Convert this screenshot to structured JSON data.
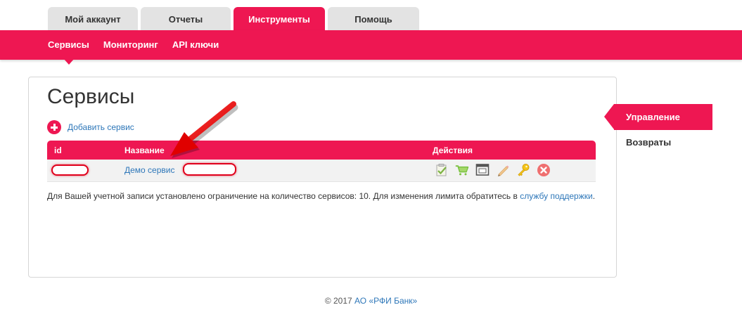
{
  "tabs": [
    {
      "label": "Мой аккаунт"
    },
    {
      "label": "Отчеты"
    },
    {
      "label": "Инструменты"
    },
    {
      "label": "Помощь"
    }
  ],
  "subnav": {
    "items": [
      {
        "label": "Сервисы"
      },
      {
        "label": "Мониторинг"
      },
      {
        "label": "API ключи"
      }
    ]
  },
  "main": {
    "title": "Сервисы",
    "add_service": "Добавить сервис",
    "table": {
      "columns": {
        "id": "id",
        "name": "Название",
        "actions": "Действия"
      },
      "rows": [
        {
          "name": "Демо сервис"
        }
      ]
    },
    "notice": {
      "text": "Для Вашей учетной записи установлено ограничение на количество сервисов: 10. Для изменения лимита обратитесь в ",
      "link": "службу поддержки",
      "end": "."
    }
  },
  "sidebar": {
    "items": [
      {
        "label": "Управление"
      },
      {
        "label": "Возвраты"
      }
    ]
  },
  "footer": {
    "copyright": "© 2017",
    "company": "АО «РФИ Банк»"
  },
  "icons": {
    "actions": [
      "checklist-icon",
      "cart-icon",
      "window-icon",
      "pencil-icon",
      "key-icon",
      "delete-icon"
    ]
  },
  "colors": {
    "accent": "#ee1752",
    "link": "#2e77b9",
    "tab_inactive": "#e3e3e3"
  }
}
